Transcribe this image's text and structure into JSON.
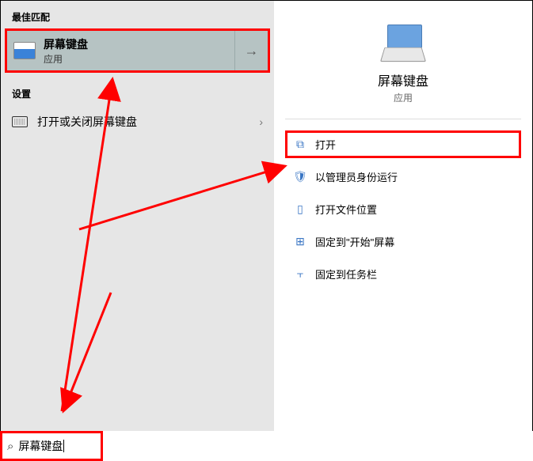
{
  "left": {
    "best_match_header": "最佳匹配",
    "best_match": {
      "title": "屏幕键盘",
      "subtitle": "应用"
    },
    "settings_header": "设置",
    "settings_item": "打开或关闭屏幕键盘"
  },
  "right": {
    "title": "屏幕键盘",
    "subtitle": "应用",
    "actions": {
      "open": "打开",
      "admin": "以管理员身份运行",
      "location": "打开文件位置",
      "pin_start": "固定到\"开始\"屏幕",
      "pin_taskbar": "固定到任务栏"
    }
  },
  "search": {
    "value": "屏幕键盘"
  },
  "colors": {
    "highlight": "#ff0000",
    "accent": "#3a76c4"
  }
}
